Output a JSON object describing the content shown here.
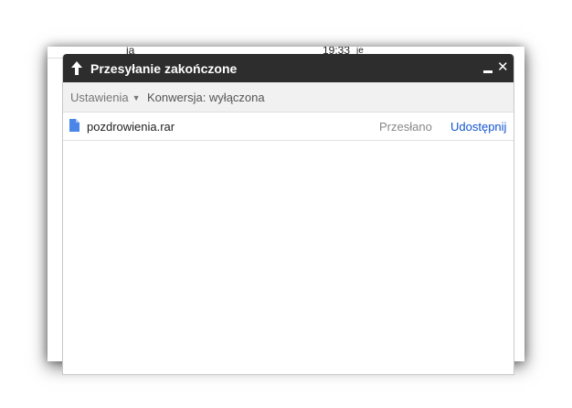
{
  "background": {
    "left_text": "ja",
    "time": "19:33",
    "suffix": "je"
  },
  "dialog": {
    "title": "Przesyłanie zakończone",
    "icons": {
      "title": "upload-arrow-icon",
      "minimize": "minimize-icon",
      "close": "close-icon",
      "file": "document-icon"
    },
    "close_glyph": "✕",
    "colors": {
      "titlebar": "#2d2d2d",
      "link": "#1155cc",
      "file_icon": "#4a86e8"
    }
  },
  "toolbar": {
    "settings_label": "Ustawienia",
    "settings_caret": "▼",
    "conversion_label": "Konwersja: wyłączona"
  },
  "files": [
    {
      "name": "pozdrowienia.rar",
      "status": "Przesłano",
      "action": "Udostępnij"
    }
  ]
}
